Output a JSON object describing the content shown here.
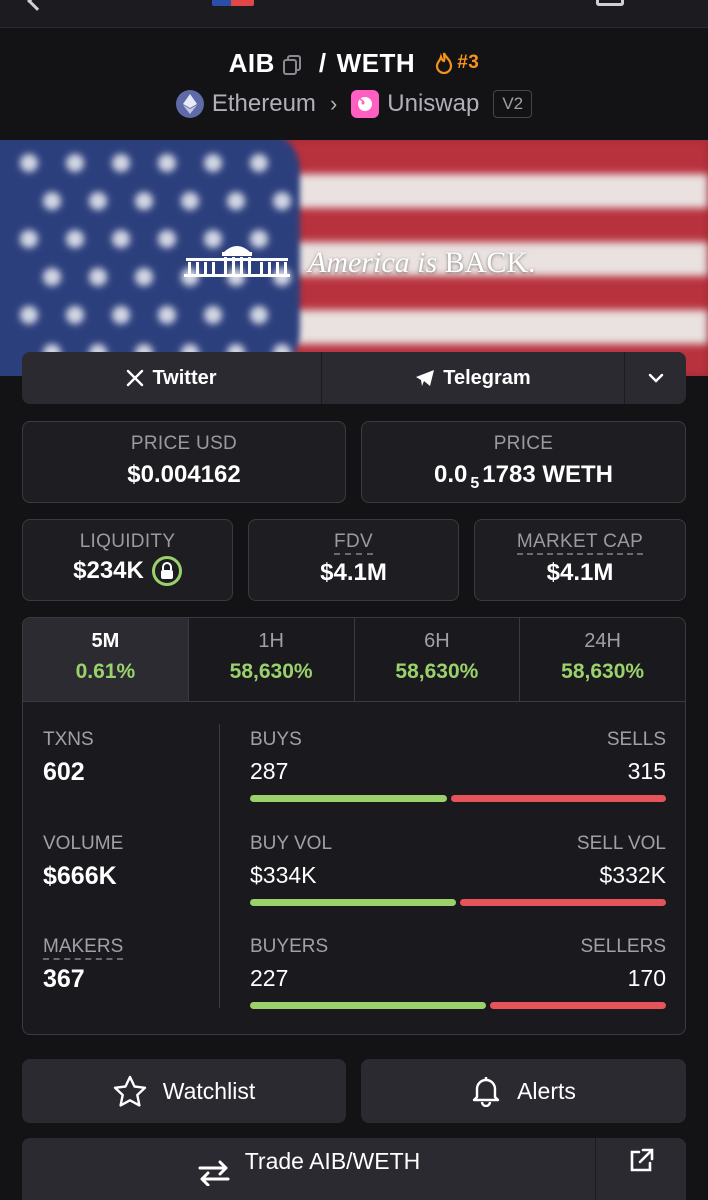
{
  "header": {
    "base_token": "AIB",
    "quote_token": "WETH",
    "separator": "/",
    "rank": "#3",
    "chain": "Ethereum",
    "dex": "Uniswap",
    "version": "V2"
  },
  "banner": {
    "text_italic": "America is",
    "text_plain": " BACK."
  },
  "social": {
    "twitter_label": "Twitter",
    "telegram_label": "Telegram"
  },
  "price": {
    "usd_label": "PRICE USD",
    "usd_value": "$0.004162",
    "native_label": "PRICE",
    "native_prefix": "0.0",
    "native_subscript": "5",
    "native_rest": "1783 WETH"
  },
  "info": {
    "liquidity_label": "LIQUIDITY",
    "liquidity_value": "$234K",
    "fdv_label": "FDV",
    "fdv_value": "$4.1M",
    "mcap_label": "MARKET CAP",
    "mcap_value": "$4.1M"
  },
  "timeframes": [
    {
      "label": "5M",
      "change": "0.61%"
    },
    {
      "label": "1H",
      "change": "58,630%"
    },
    {
      "label": "6H",
      "change": "58,630%"
    },
    {
      "label": "24H",
      "change": "58,630%"
    }
  ],
  "metrics": {
    "txns_label": "TXNS",
    "txns_value": "602",
    "volume_label": "VOLUME",
    "volume_value": "$666K",
    "makers_label": "MAKERS",
    "makers_value": "367",
    "buys_label": "BUYS",
    "buys_value": "287",
    "sells_label": "SELLS",
    "sells_value": "315",
    "buy_vol_label": "BUY VOL",
    "buy_vol_value": "$334K",
    "sell_vol_label": "SELL VOL",
    "sell_vol_value": "$332K",
    "buyers_label": "BUYERS",
    "buyers_value": "227",
    "sellers_label": "SELLERS",
    "sellers_value": "170",
    "buy_share": 0.477,
    "buy_vol_share": 0.501,
    "buyers_share": 0.572
  },
  "actions": {
    "watchlist_label": "Watchlist",
    "alerts_label": "Alerts",
    "trade_label": "Trade AIB/WETH"
  },
  "colors": {
    "positive": "#9bd16b",
    "negative": "#e5535b",
    "accent_rank": "#f7931a"
  }
}
